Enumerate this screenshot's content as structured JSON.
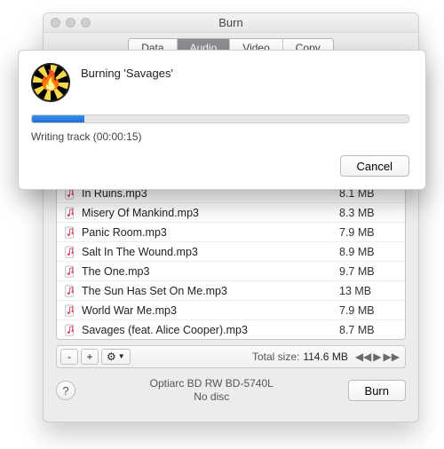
{
  "window": {
    "title": "Burn"
  },
  "tabs": {
    "data": "Data",
    "audio": "Audio",
    "video": "Video",
    "copy": "Copy"
  },
  "files": [
    {
      "name": "In Ruins.mp3",
      "size": "8.1 MB"
    },
    {
      "name": "Misery Of Mankind.mp3",
      "size": "8.3 MB"
    },
    {
      "name": "Panic Room.mp3",
      "size": "7.9 MB"
    },
    {
      "name": "Salt In The Wound.mp3",
      "size": "8.9 MB"
    },
    {
      "name": "The One.mp3",
      "size": "9.7 MB"
    },
    {
      "name": "The Sun Has Set On Me.mp3",
      "size": "13 MB"
    },
    {
      "name": "World War Me.mp3",
      "size": "7.9 MB"
    },
    {
      "name": "Savages (feat. Alice Cooper).mp3",
      "size": "8.7 MB"
    }
  ],
  "toolbar": {
    "remove_label": "-",
    "add_label": "+",
    "total_label": "Total size:",
    "total_value": "114.6 MB"
  },
  "footer": {
    "help_label": "?",
    "drive_name": "Optiarc BD RW BD-5740L",
    "drive_status": "No disc",
    "burn_label": "Burn"
  },
  "sheet": {
    "title": "Burning 'Savages'",
    "status": "Writing track (00:00:15)",
    "progress_percent": 14,
    "cancel_label": "Cancel"
  }
}
